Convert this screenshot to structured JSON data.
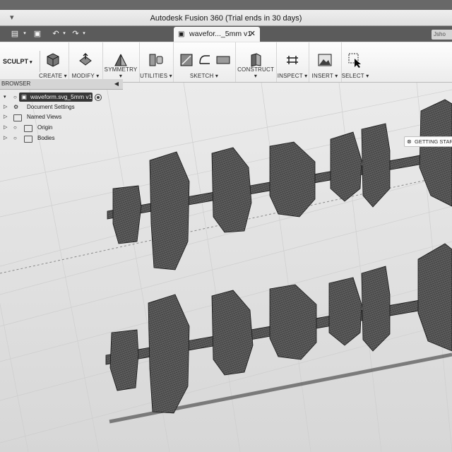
{
  "window": {
    "title": "Autodesk Fusion 360 (Trial ends in 30 days)"
  },
  "tabs": {
    "active_document": "wavefor..._5mm v1",
    "close_glyph": "✕",
    "user_chip": "Jsho"
  },
  "toolbar": {
    "workspace": "SCULPT",
    "groups": [
      {
        "label": "CREATE",
        "icon": "create-box-icon"
      },
      {
        "label": "MODIFY",
        "icon": "modify-icon"
      },
      {
        "label": "SYMMETRY",
        "icon": "symmetry-icon"
      },
      {
        "label": "UTILITIES",
        "icon": "utilities-icon"
      },
      {
        "label": "SKETCH",
        "icon": "sketch-icon"
      },
      {
        "label": "CONSTRUCT",
        "icon": "construct-icon"
      },
      {
        "label": "INSPECT",
        "icon": "inspect-icon"
      },
      {
        "label": "INSERT",
        "icon": "insert-image-icon"
      },
      {
        "label": "SELECT",
        "icon": "select-arrow-icon"
      }
    ]
  },
  "browser": {
    "header": "BROWSER",
    "root": "waveform.svg_5mm v1",
    "items": [
      {
        "label": "Document Settings",
        "icon": "gear-icon"
      },
      {
        "label": "Named Views",
        "icon": "folder-icon"
      },
      {
        "label": "Origin",
        "icon": "folder-icon"
      },
      {
        "label": "Bodies",
        "icon": "folder-icon"
      }
    ]
  },
  "viewport": {
    "getting_started": "GETTING STARTED"
  }
}
